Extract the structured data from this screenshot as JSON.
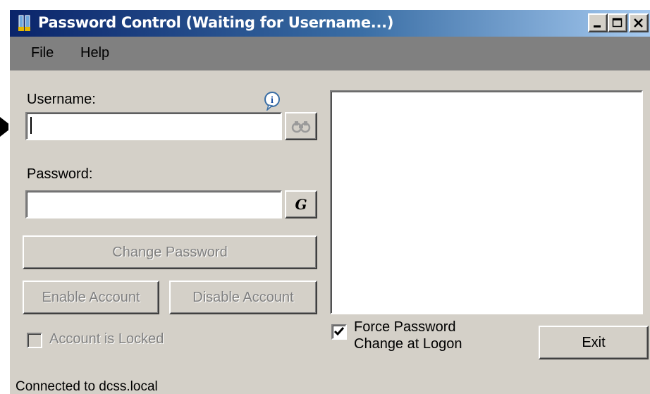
{
  "window": {
    "title": "Password Control  (Waiting for Username...)",
    "controls": [
      "minimize-icon",
      "maximize-icon",
      "close-icon"
    ]
  },
  "menu": {
    "items": [
      "File",
      "Help"
    ]
  },
  "form": {
    "username_label": "Username:",
    "username_value": "",
    "username_help_icon": "info-icon",
    "lookup_icon": "binoculars-icon",
    "password_label": "Password:",
    "password_value": "",
    "generate_label": "G",
    "change_password_label": "Change Password",
    "enable_account_label": "Enable Account",
    "disable_account_label": "Disable Account",
    "account_locked_label": "Account is Locked",
    "account_locked_checked": false
  },
  "right": {
    "force_password_line1": "Force Password",
    "force_password_line2": "Change at Logon",
    "force_password_checked": true,
    "exit_label": "Exit"
  },
  "status": {
    "text": "Connected to dcss.local"
  },
  "colors": {
    "titlebar_start": "#0a246a",
    "titlebar_end": "#a6caf0",
    "face": "#d4d0c8",
    "menubar": "#808080"
  }
}
